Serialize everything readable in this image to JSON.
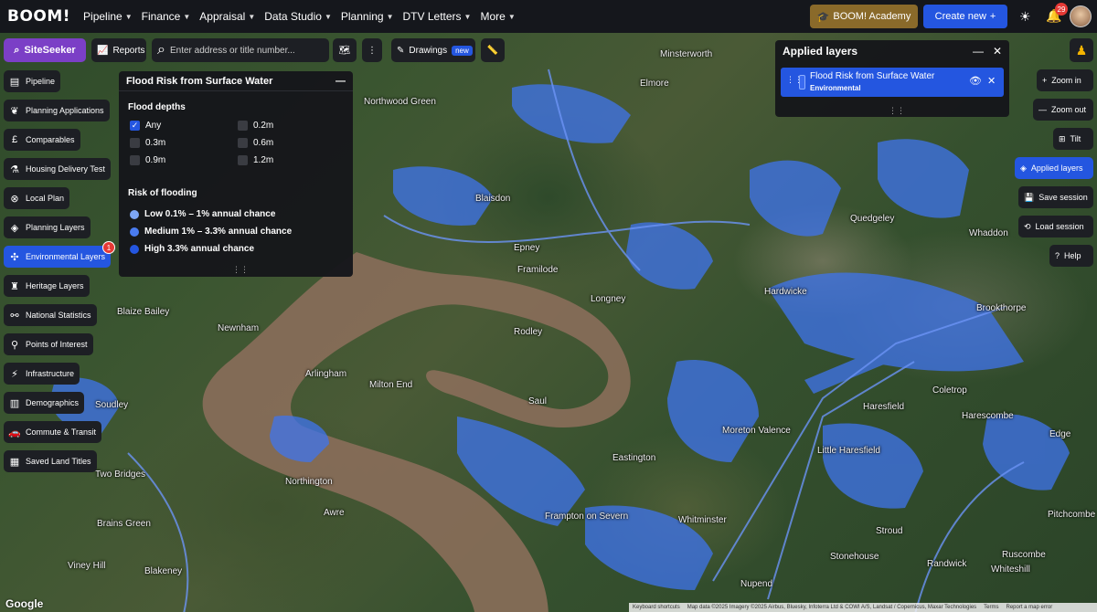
{
  "topnav": {
    "logo": "BOOM!",
    "items": [
      "Pipeline",
      "Finance",
      "Appraisal",
      "Data Studio",
      "Planning",
      "DTV Letters",
      "More"
    ],
    "academy": "BOOM! Academy",
    "create_new": "Create new",
    "notifications_count": "29"
  },
  "toolbar": {
    "siteseeker": "SiteSeeker",
    "reports": "Reports",
    "search_placeholder": "Enter address or title number...",
    "drawings": "Drawings",
    "drawings_badge": "new"
  },
  "sidebar": {
    "items": [
      "Pipeline",
      "Planning Applications",
      "Comparables",
      "Housing Delivery Test",
      "Local Plan",
      "Planning Layers",
      "Environmental Layers",
      "Heritage Layers",
      "National Statistics",
      "Points of Interest",
      "Infrastructure",
      "Demographics",
      "Commute & Transit",
      "Saved Land Titles"
    ],
    "active_badge": "1"
  },
  "flood_panel": {
    "title": "Flood Risk from Surface Water",
    "depths_title": "Flood depths",
    "depths": [
      "Any",
      "0.2m",
      "0.3m",
      "0.6m",
      "0.9m",
      "1.2m"
    ],
    "risk_title": "Risk of flooding",
    "risks": [
      {
        "label": "Low 0.1% – 1% annual chance",
        "color": "#7da6f5"
      },
      {
        "label": "Medium 1% – 3.3% annual chance",
        "color": "#4a7cf0"
      },
      {
        "label": "High 3.3% annual chance",
        "color": "#2456e0"
      }
    ]
  },
  "applied_layers": {
    "title": "Applied layers",
    "layer_name": "Flood Risk from Surface Water",
    "layer_category": "Environmental"
  },
  "right_controls": {
    "zoom_in": "Zoom in",
    "zoom_out": "Zoom out",
    "tilt": "Tilt",
    "applied_layers": "Applied layers",
    "save_session": "Save session",
    "load_session": "Load session",
    "help": "Help"
  },
  "map": {
    "places": [
      "Minsterworth",
      "Northwood Green",
      "Longney",
      "Rodley",
      "Arlingham",
      "Milton End",
      "Frampton on Severn",
      "Saul",
      "Whitminster",
      "Moreton Valence",
      "Hardwicke",
      "Quedgeley",
      "Elmore",
      "Epney",
      "Framilode",
      "Blaisdon",
      "Newnham",
      "Blaize Bailey",
      "Northington",
      "Awre",
      "Two Bridges",
      "Brains Green",
      "Viney Hill",
      "Blakeney",
      "Soudley",
      "Whaddon",
      "Brookthorpe",
      "Edge",
      "Harescombe",
      "Coletrop",
      "Pitchcombe",
      "Randwick",
      "Ruscombe",
      "Whiteshill",
      "Stroud",
      "Stonehouse",
      "Eastington",
      "Nupend",
      "Little Haresfield",
      "Haresfield"
    ],
    "attribution": [
      "Keyboard shortcuts",
      "Map data ©2025 Imagery ©2025 Airbus, Bluesky, Infoterra Ltd & COWI A/S, Landsat / Copernicus, Maxar Technologies",
      "Terms",
      "Report a map error"
    ],
    "google": "Google"
  }
}
